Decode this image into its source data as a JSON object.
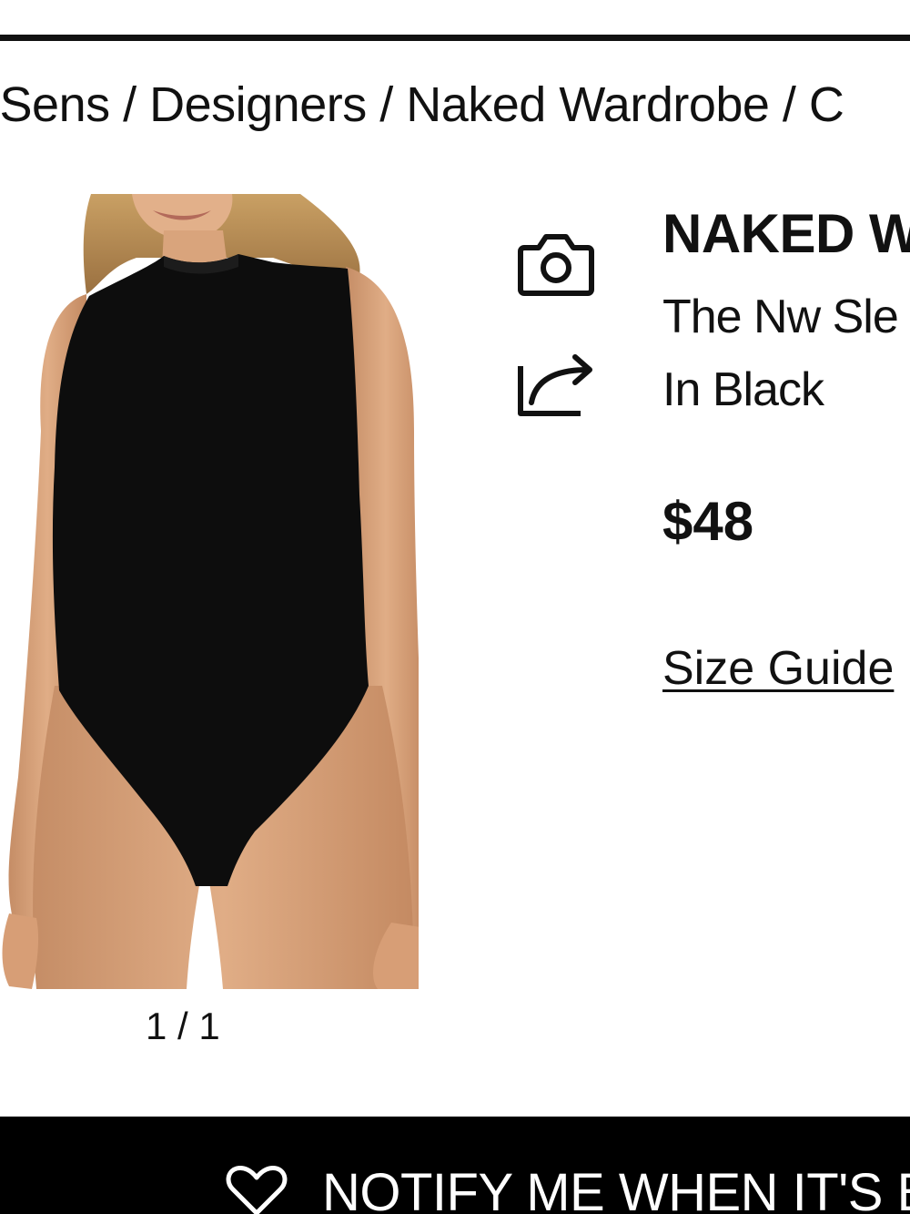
{
  "breadcrumb": "eSens / Designers / Naked Wardrobe / C",
  "gallery": {
    "counter": "1 / 1"
  },
  "actions": {
    "camera_icon": "camera-icon",
    "share_icon": "share-icon"
  },
  "product": {
    "brand": "NAKED W",
    "name": "The Nw Sle",
    "color": "In Black",
    "price": "$48",
    "size_guide_label": "Size Guide"
  },
  "notify": {
    "icon": "heart-icon",
    "label": "NOTIFY ME WHEN IT'S BA"
  },
  "colors": {
    "text": "#111111",
    "bar": "#000000",
    "background": "#ffffff"
  }
}
